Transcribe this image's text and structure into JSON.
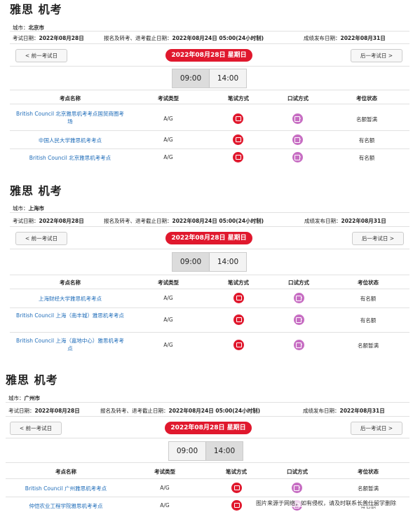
{
  "sections": [
    {
      "title": "雅思 机考",
      "city_label": "城市：",
      "city": "北京市",
      "exam_date_label": "考试日期：",
      "exam_date": "2022年08月28日",
      "deadline_label": "报名及转考、退考截止日期：",
      "deadline": "2022年08月24日 05:00(24小时制)",
      "result_label": "成绩发布日期：",
      "result_date": "2022年08月31日",
      "prev": "< 前一考试日",
      "next": "后一考试日 >",
      "date_pill": "2022年08月28日 星期日",
      "times": [
        "09:00",
        "14:00"
      ],
      "headers": [
        "考点名称",
        "考试类型",
        "笔试方式",
        "口试方式",
        "考位状态"
      ],
      "rows": [
        {
          "name": "British Council 北京雅思机考考点国贸商圈考场",
          "type": "A/G",
          "status": "名额暂满"
        },
        {
          "name": "中国人民大学雅思机考考点",
          "type": "A/G",
          "status": "有名额"
        },
        {
          "name": "British Council 北京雅思机考考点",
          "type": "A/G",
          "status": "有名额"
        }
      ]
    },
    {
      "title": "雅思 机考",
      "city_label": "城市：",
      "city": "上海市",
      "exam_date_label": "考试日期：",
      "exam_date": "2022年08月28日",
      "deadline_label": "报名及转考、退考截止日期：",
      "deadline": "2022年08月24日 05:00(24小时制)",
      "result_label": "成绩发布日期：",
      "result_date": "2022年08月31日",
      "prev": "< 前一考试日",
      "next": "后一考试日 >",
      "date_pill": "2022年08月28日 星期日",
      "times": [
        "09:00",
        "14:00"
      ],
      "headers": [
        "考点名称",
        "考试类型",
        "笔试方式",
        "口试方式",
        "考位状态"
      ],
      "rows": [
        {
          "name": "上海财经大学雅思机考考点",
          "type": "A/G",
          "status": "有名额"
        },
        {
          "name": "British Council 上海（南丰城）雅思机考考点",
          "type": "A/G",
          "status": "有名额"
        },
        {
          "name": "British Council 上海（嘉地中心）雅思机考考点",
          "type": "A/G",
          "status": "名额暂满"
        }
      ]
    },
    {
      "title": "雅思 机考",
      "city_label": "城市：",
      "city": "广州市",
      "exam_date_label": "考试日期：",
      "exam_date": "2022年08月28日",
      "deadline_label": "报名及转考、退考截止日期：",
      "deadline": "2022年08月24日 05:00(24小时制)",
      "result_label": "成绩发布日期：",
      "result_date": "2022年08月31日",
      "prev": "< 前一考试日",
      "next": "后一考试日 >",
      "date_pill": "2022年08月28日 星期日",
      "times": [
        "09:00",
        "14:00"
      ],
      "headers": [
        "考点名称",
        "考试类型",
        "笔试方式",
        "口试方式",
        "考位状态"
      ],
      "rows": [
        {
          "name": "British Council 广州雅思机考考点",
          "type": "A/G",
          "status": "名额暂满"
        },
        {
          "name": "仲恺农业工程学院雅思机考考点",
          "type": "A/G",
          "status": "有名额"
        }
      ]
    }
  ],
  "watermark": "图片来源于网络，如有侵权，请及时联系长普仕留学删除",
  "colors": {
    "accent": "#e0182d",
    "link": "#1d6bb8",
    "oral_icon": "#c76ec3"
  },
  "icons": {
    "written": "computer-icon",
    "oral": "video-icon"
  }
}
